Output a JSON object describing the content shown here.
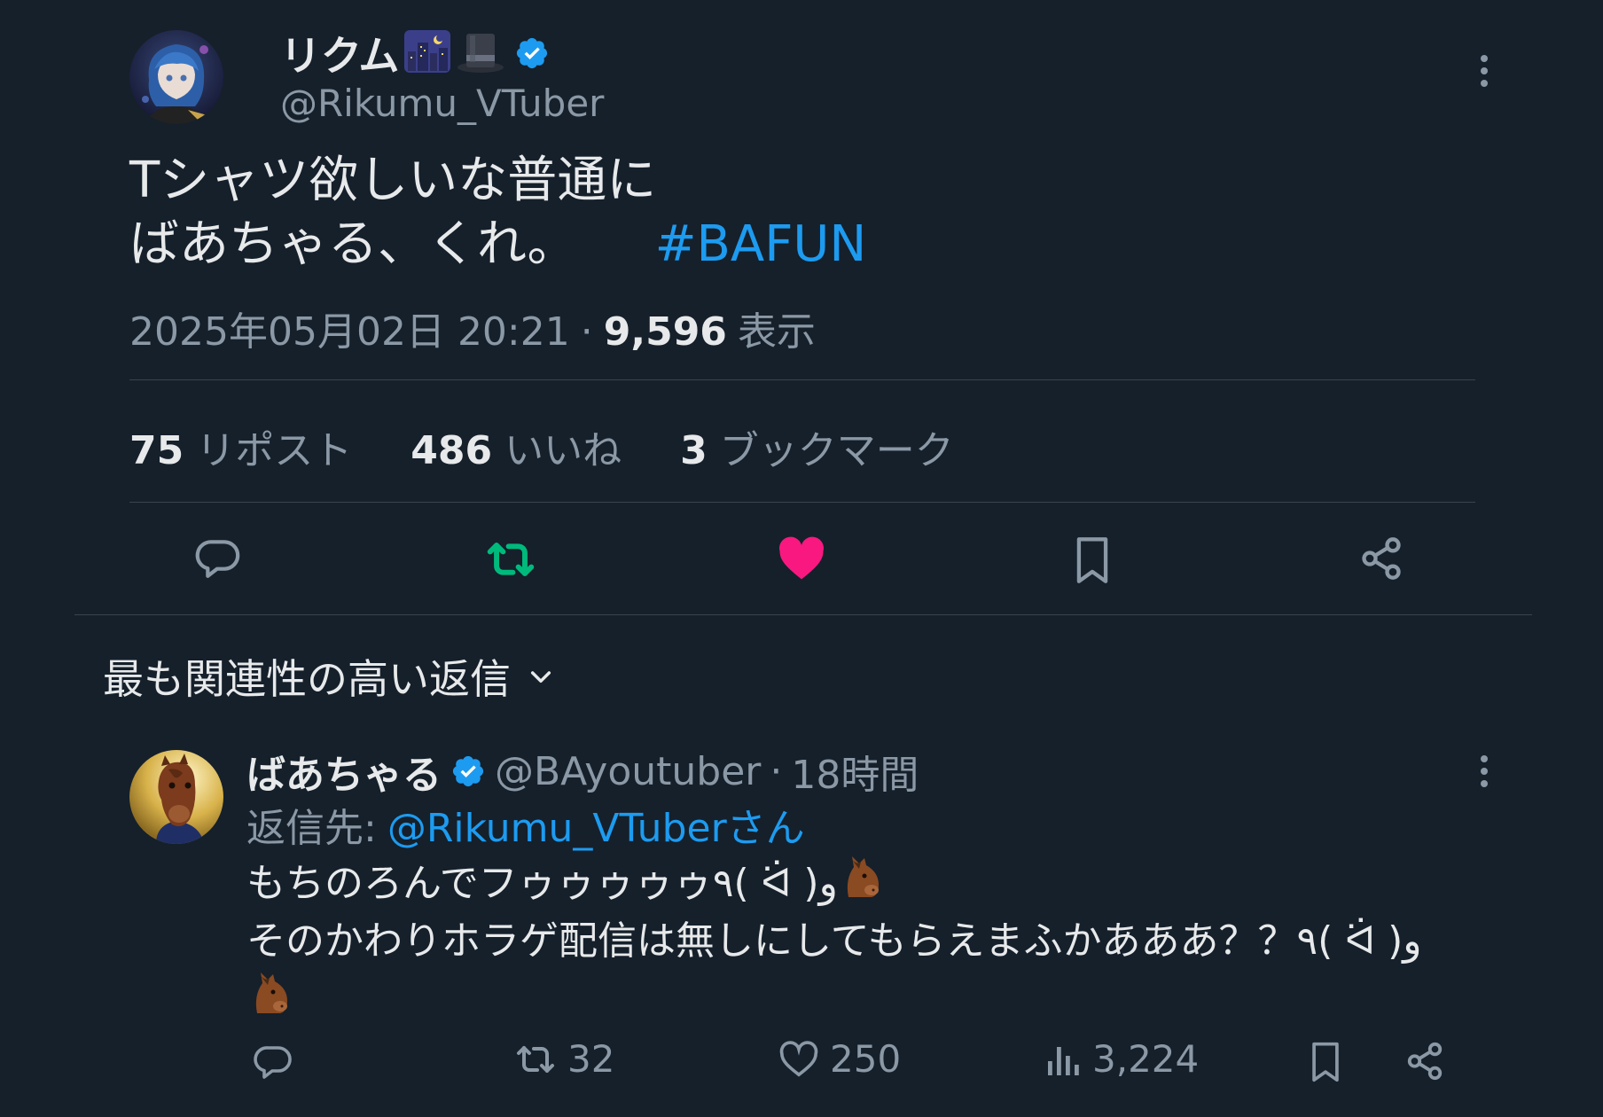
{
  "main_tweet": {
    "author": {
      "name": "リクム",
      "name_emoji": [
        "city-night-emoji",
        "top-hat-emoji"
      ],
      "handle": "@Rikumu_VTuber",
      "verified": true
    },
    "text_line1": "Tシャツ欲しいな普通に",
    "text_line2": "ばあちゃる、くれ。",
    "hashtag": "#BAFUN",
    "timestamp": "2025年05月02日 20:21",
    "separator": "·",
    "views": "9,596",
    "views_label": "表示",
    "stats": {
      "reposts": "75",
      "reposts_label": "リポスト",
      "likes": "486",
      "likes_label": "いいね",
      "bookmarks": "3",
      "bookmarks_label": "ブックマーク"
    },
    "actions": [
      "reply-icon",
      "repost-icon",
      "like-icon",
      "bookmark-icon",
      "share-icon"
    ]
  },
  "sort": {
    "label": "最も関連性の高い返信"
  },
  "reply": {
    "author": {
      "name": "ばあちゃる",
      "handle": "@BAyoutuber",
      "separator": "·",
      "time": "18時間",
      "verified": true
    },
    "reply_to_label": "返信先:",
    "reply_to_handle": "@Rikumu_VTuberさん",
    "text_line1": "もちのろんでフゥゥゥゥゥ٩( ᐛ )و",
    "text_line2": "そのかわりホラゲ配信は無しにしてもらえまふかあああ？？٩( ᐛ )و",
    "stats": {
      "reposts": "32",
      "likes": "250",
      "views": "3,224"
    }
  },
  "colors": {
    "background": "#15202b",
    "text": "#e7e9ea",
    "muted": "#8b98a5",
    "link": "#1d9bf0",
    "repost_active": "#00ba7c",
    "like_active": "#f91880",
    "divider": "#38444d"
  }
}
